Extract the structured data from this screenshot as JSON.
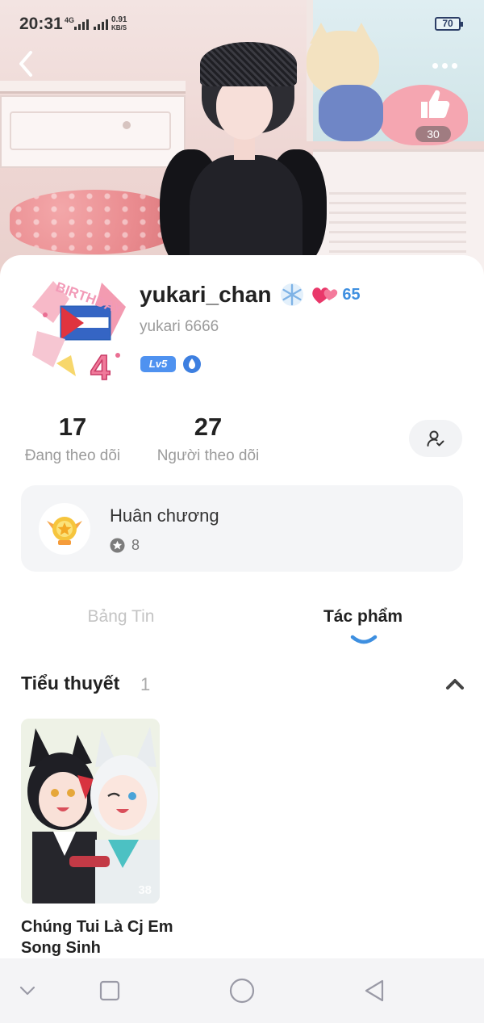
{
  "status_bar": {
    "time": "20:31",
    "network": "4G",
    "speed_value": "0.91",
    "speed_unit": "KB/S",
    "battery": "70"
  },
  "banner": {
    "back_icon": "chevron-left-icon",
    "more_icon": "more-dots-icon",
    "like_icon": "thumbs-up-icon",
    "like_count": "30"
  },
  "profile": {
    "username": "yukari_chan",
    "username_badge_icon": "snowflake-icon",
    "heart_icon": "hearts-icon",
    "heart_count": "65",
    "handle": "yukari 6666",
    "level_badge": "Lv5",
    "accent_color": "#3e8fe0"
  },
  "stats": {
    "following_value": "17",
    "following_label": "Đang theo dõi",
    "followers_value": "27",
    "followers_label": "Người theo dõi",
    "follow_button_icon": "user-check-icon"
  },
  "medals": {
    "title": "Huân chương",
    "count": "8"
  },
  "tabs": [
    {
      "label": "Bảng Tin",
      "active": false
    },
    {
      "label": "Tác phẩm",
      "active": true
    }
  ],
  "section": {
    "title": "Tiểu thuyết",
    "count": "1",
    "collapse_icon": "chevron-up-icon"
  },
  "works": [
    {
      "title": "Chúng Tui Là Cj Em Song Sinh",
      "views": "38"
    }
  ],
  "nav_bar": {
    "icons": [
      "chevron-down-icon",
      "square-icon",
      "circle-icon",
      "triangle-back-icon"
    ]
  }
}
